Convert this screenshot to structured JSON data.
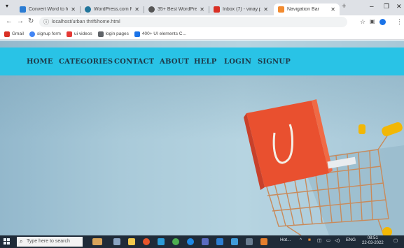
{
  "browser": {
    "tabs": [
      {
        "title": "Convert Word to format",
        "color": "#2b7cd3"
      },
      {
        "title": "WordPress.com Pricing",
        "color": "#21759b"
      },
      {
        "title": "35+ Best WordPress Th",
        "color": "#555555"
      },
      {
        "title": "Inbox (7) - vinay.padei",
        "color": "#d93025"
      },
      {
        "title": "Navigation Bar",
        "color": "#f28b30",
        "active": true
      }
    ],
    "new_tab": "+",
    "url": "localhost/urban thrift/home.html",
    "bookmarks": [
      {
        "label": "Gmail",
        "color": "#d93025"
      },
      {
        "label": "signup form",
        "color": "#4285f4"
      },
      {
        "label": "ui videos",
        "color": "#e53935"
      },
      {
        "label": "login pages",
        "color": "#5f6368"
      },
      {
        "label": "400+ UI elements C...",
        "color": "#1a73e8"
      }
    ]
  },
  "site": {
    "nav": [
      "HOME",
      "CATEGORIES",
      "CONTACT",
      "ABOUT",
      "HELP",
      "LOGIN",
      "SIGNUP"
    ],
    "colors": {
      "navbar": "#29c3e6",
      "nav_text": "#1d3a4a",
      "bag": "#e9502f",
      "cart": "#c98a5a"
    }
  },
  "taskbar": {
    "search_placeholder": "Type here to search",
    "tray_text": "Hot...",
    "lang": "ENG",
    "time": "08:51",
    "date": "22-03-2022"
  }
}
